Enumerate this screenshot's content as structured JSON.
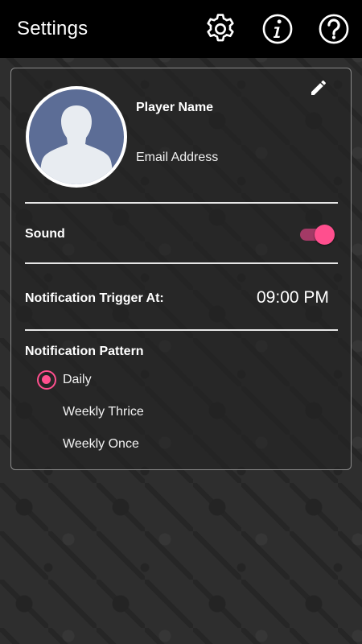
{
  "app": {
    "title": "Settings",
    "accent_color": "#ff4f8e",
    "toolbar_icons": [
      "gear-icon",
      "info-icon",
      "help-icon"
    ]
  },
  "profile": {
    "player_name": "Player Name",
    "email": "Email Address",
    "avatar_icon": "person-silhouette-icon",
    "edit_icon": "pencil-icon"
  },
  "sound": {
    "label": "Sound",
    "enabled": true
  },
  "notification_trigger": {
    "label": "Notification Trigger At:",
    "time": "09:00 PM"
  },
  "notification_pattern": {
    "label": "Notification Pattern",
    "options": [
      {
        "label": "Daily",
        "selected": true
      },
      {
        "label": "Weekly Thrice",
        "selected": false
      },
      {
        "label": "Weekly Once",
        "selected": false
      }
    ]
  }
}
